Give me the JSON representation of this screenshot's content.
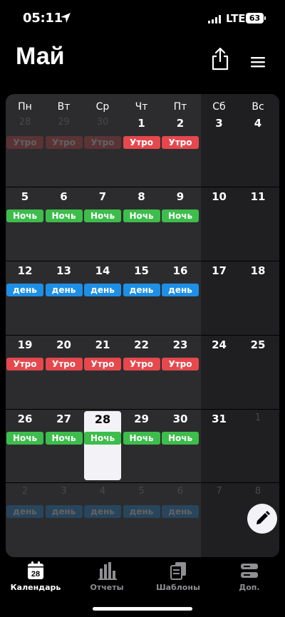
{
  "status": {
    "time": "05:11",
    "network": "LTE",
    "battery": "63"
  },
  "header": {
    "title": "Май"
  },
  "weekdays": [
    "Пн",
    "Вт",
    "Ср",
    "Чт",
    "Пт",
    "Сб",
    "Вс"
  ],
  "colors": {
    "morning": "#e5484d",
    "night": "#3dbd4b",
    "day": "#1e8fe6"
  },
  "weeks": [
    {
      "days": [
        {
          "num": "28",
          "faded": true,
          "shift": "Утро",
          "type": "morning"
        },
        {
          "num": "29",
          "faded": true,
          "shift": "Утро",
          "type": "morning"
        },
        {
          "num": "30",
          "faded": true,
          "shift": "Утро",
          "type": "morning"
        },
        {
          "num": "1",
          "faded": false,
          "shift": "Утро",
          "type": "morning"
        },
        {
          "num": "2",
          "faded": false,
          "shift": "Утро",
          "type": "morning"
        },
        {
          "num": "3",
          "faded": false
        },
        {
          "num": "4",
          "faded": false
        }
      ]
    },
    {
      "days": [
        {
          "num": "5",
          "faded": false,
          "shift": "Ночь",
          "type": "night"
        },
        {
          "num": "6",
          "faded": false,
          "shift": "Ночь",
          "type": "night"
        },
        {
          "num": "7",
          "faded": false,
          "shift": "Ночь",
          "type": "night"
        },
        {
          "num": "8",
          "faded": false,
          "shift": "Ночь",
          "type": "night"
        },
        {
          "num": "9",
          "faded": false,
          "shift": "Ночь",
          "type": "night"
        },
        {
          "num": "10",
          "faded": false
        },
        {
          "num": "11",
          "faded": false
        }
      ]
    },
    {
      "days": [
        {
          "num": "12",
          "faded": false,
          "shift": "день",
          "type": "day"
        },
        {
          "num": "13",
          "faded": false,
          "shift": "день",
          "type": "day"
        },
        {
          "num": "14",
          "faded": false,
          "shift": "день",
          "type": "day"
        },
        {
          "num": "15",
          "faded": false,
          "shift": "день",
          "type": "day"
        },
        {
          "num": "16",
          "faded": false,
          "shift": "день",
          "type": "day"
        },
        {
          "num": "17",
          "faded": false
        },
        {
          "num": "18",
          "faded": false
        }
      ]
    },
    {
      "days": [
        {
          "num": "19",
          "faded": false,
          "shift": "Утро",
          "type": "morning"
        },
        {
          "num": "20",
          "faded": false,
          "shift": "Утро",
          "type": "morning"
        },
        {
          "num": "21",
          "faded": false,
          "shift": "Утро",
          "type": "morning"
        },
        {
          "num": "22",
          "faded": false,
          "shift": "Утро",
          "type": "morning"
        },
        {
          "num": "23",
          "faded": false,
          "shift": "Утро",
          "type": "morning"
        },
        {
          "num": "24",
          "faded": false
        },
        {
          "num": "25",
          "faded": false
        }
      ]
    },
    {
      "days": [
        {
          "num": "26",
          "faded": false,
          "shift": "Ночь",
          "type": "night"
        },
        {
          "num": "27",
          "faded": false,
          "shift": "Ночь",
          "type": "night"
        },
        {
          "num": "28",
          "faded": false,
          "shift": "Ночь",
          "type": "night",
          "today": true
        },
        {
          "num": "29",
          "faded": false,
          "shift": "Ночь",
          "type": "night"
        },
        {
          "num": "30",
          "faded": false,
          "shift": "Ночь",
          "type": "night"
        },
        {
          "num": "31",
          "faded": false
        },
        {
          "num": "1",
          "faded": true
        }
      ]
    },
    {
      "days": [
        {
          "num": "2",
          "faded": true,
          "shift": "день",
          "type": "day"
        },
        {
          "num": "3",
          "faded": true,
          "shift": "день",
          "type": "day"
        },
        {
          "num": "4",
          "faded": true,
          "shift": "день",
          "type": "day"
        },
        {
          "num": "5",
          "faded": true,
          "shift": "день",
          "type": "day"
        },
        {
          "num": "6",
          "faded": true,
          "shift": "день",
          "type": "day"
        },
        {
          "num": "7",
          "faded": true
        },
        {
          "num": "8",
          "faded": true
        }
      ]
    }
  ],
  "tabs": [
    {
      "label": "Календарь",
      "icon": "calendar-icon",
      "badge": "28",
      "active": true
    },
    {
      "label": "Отчеты",
      "icon": "bar-chart-icon",
      "active": false
    },
    {
      "label": "Шаблоны",
      "icon": "copy-icon",
      "active": false
    },
    {
      "label": "Доп.",
      "icon": "server-icon",
      "active": false
    }
  ]
}
